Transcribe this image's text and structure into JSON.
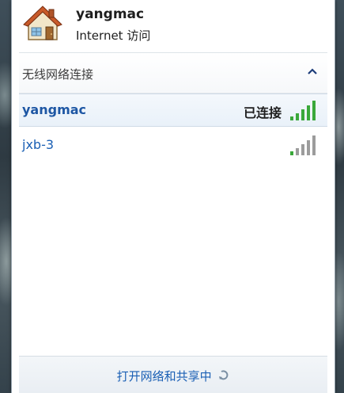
{
  "connection": {
    "name": "yangmac",
    "status": "Internet 访问"
  },
  "section": {
    "title": "无线网络连接"
  },
  "networks": [
    {
      "name": "yangmac",
      "state": "已连接",
      "signal_icon": "signal-strength-full-green-icon"
    },
    {
      "name": "jxb-3",
      "state": "",
      "signal_icon": "signal-strength-gray-icon"
    }
  ],
  "footer": {
    "link": "打开网络和共享中"
  },
  "colors": {
    "link": "#1a5fb4",
    "signal_active": "#3aa83a",
    "signal_inactive": "#9c9c9c"
  }
}
